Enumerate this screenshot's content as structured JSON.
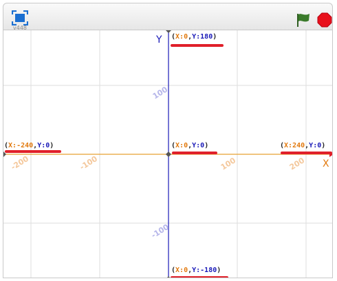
{
  "toolbar": {
    "version": "v448",
    "fullscreen_icon": "fullscreen-icon",
    "green_flag_icon": "green-flag-icon",
    "stop_icon": "stop-sign-icon"
  },
  "colors": {
    "x_axis": "#e8a030",
    "y_axis": "#1a1ab8",
    "x_label": "#e27a0f",
    "y_label": "#1a1ab8",
    "x_ticks": "#f4c89c",
    "y_ticks": "#b6b6ea",
    "grid": "#dddddd",
    "highlight": "#e0202a",
    "flag": "#3a7a2a",
    "stop": "#e8101c"
  },
  "axes": {
    "x_name": "X",
    "y_name": "Y",
    "x_ticks": [
      "-200",
      "-100",
      "100",
      "200"
    ],
    "y_ticks": [
      "100",
      "-100"
    ]
  },
  "points": {
    "top": {
      "lp": "(",
      "x": "X:0",
      "comma": ",",
      "y": "Y:180",
      "rp": ")"
    },
    "left": {
      "lp": "(",
      "x": "X:-240",
      "comma": ",",
      "y": "Y:0",
      "rp": ")"
    },
    "center": {
      "lp": "(",
      "x": "X:0",
      "comma": ",",
      "y": "Y:0",
      "rp": ")"
    },
    "right": {
      "lp": "(",
      "x": "X:240",
      "comma": ",",
      "y": "Y:0",
      "rp": ")"
    },
    "bottom": {
      "lp": "(",
      "x": "X:0",
      "comma": ",",
      "y": "Y:-180",
      "rp": ")"
    }
  }
}
